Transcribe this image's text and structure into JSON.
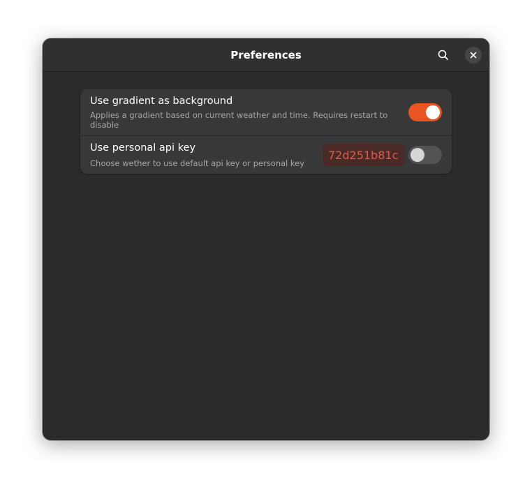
{
  "window": {
    "title": "Preferences"
  },
  "header": {
    "search_icon": "search-icon",
    "close_icon": "close-icon"
  },
  "preferences": {
    "gradient": {
      "title": "Use gradient as background",
      "subtitle": "Applies a gradient based on current weather and time. Requires restart to disable",
      "enabled": true
    },
    "api_key": {
      "title": "Use personal api key",
      "subtitle": "Choose wether to use default api key or personal key",
      "value": "72d251b81c",
      "enabled": false
    }
  },
  "colors": {
    "accent": "#e95420",
    "window_bg": "#2b2b2b",
    "card_bg": "#383838",
    "entry_error_bg": "#4a2a26",
    "entry_error_text": "#e4584a"
  }
}
